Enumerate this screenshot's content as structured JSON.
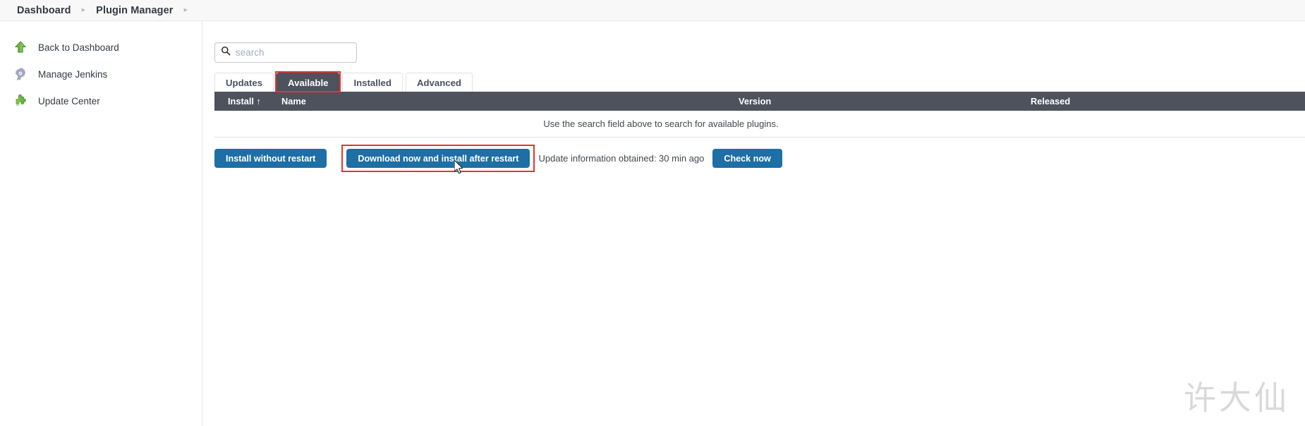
{
  "breadcrumb": {
    "items": [
      {
        "label": "Dashboard"
      },
      {
        "label": "Plugin Manager"
      }
    ],
    "separator": "▸"
  },
  "sidebar": {
    "items": [
      {
        "label": "Back to Dashboard",
        "icon": "up-arrow-icon"
      },
      {
        "label": "Manage Jenkins",
        "icon": "gear-icon"
      },
      {
        "label": "Update Center",
        "icon": "puzzle-piece-icon"
      }
    ]
  },
  "search": {
    "placeholder": "search",
    "value": "",
    "icon": "search-icon"
  },
  "tabs": [
    {
      "label": "Updates",
      "active": false,
      "annotated": false
    },
    {
      "label": "Available",
      "active": true,
      "annotated": true
    },
    {
      "label": "Installed",
      "active": false,
      "annotated": false
    },
    {
      "label": "Advanced",
      "active": false,
      "annotated": false
    }
  ],
  "table": {
    "headers": {
      "install": "Install",
      "install_sort_indicator": "↑",
      "name": "Name",
      "version": "Version",
      "released": "Released"
    },
    "empty_message": "Use the search field above to search for available plugins.",
    "rows": []
  },
  "actions": {
    "install_without_restart": "Install without restart",
    "download_now_install_after_restart": "Download now and install after restart",
    "update_information": "Update information obtained: 30 min ago",
    "check_now": "Check now"
  },
  "watermark": {
    "text": "许大仙"
  },
  "colors": {
    "accent_blue": "#1d6fa5",
    "header_dark": "#4d525d",
    "annotation_red": "#e8332a",
    "icon_green": "#6eb544",
    "breadcrumb_bg": "#f8f8f8"
  }
}
